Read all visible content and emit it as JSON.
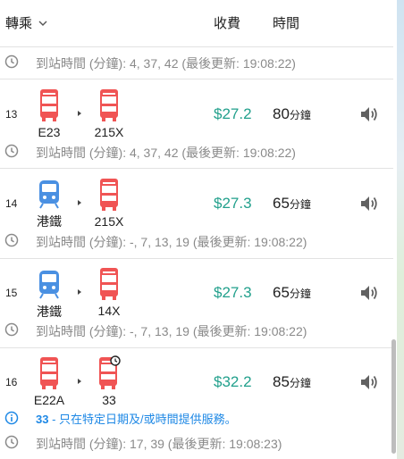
{
  "header": {
    "transfer_label": "轉乘",
    "fare_label": "收費",
    "time_label": "時間"
  },
  "eta_top": "到站時間 (分鐘): 4, 37, 42 (最後更新: 19:08:22)",
  "routes": [
    {
      "index": "13",
      "legs": [
        {
          "mode": "bus",
          "label": "E23"
        },
        {
          "mode": "bus",
          "label": "215X"
        }
      ],
      "fare": "$27.2",
      "duration": "80",
      "duration_unit": "分鐘",
      "eta": "到站時間 (分鐘): 4, 37, 42 (最後更新: 19:08:22)"
    },
    {
      "index": "14",
      "legs": [
        {
          "mode": "rail",
          "label": "港鐵"
        },
        {
          "mode": "bus",
          "label": "215X"
        }
      ],
      "fare": "$27.3",
      "duration": "65",
      "duration_unit": "分鐘",
      "eta": "到站時間 (分鐘): -, 7, 13, 19 (最後更新: 19:08:22)"
    },
    {
      "index": "15",
      "legs": [
        {
          "mode": "rail",
          "label": "港鐵"
        },
        {
          "mode": "bus",
          "label": "14X"
        }
      ],
      "fare": "$27.3",
      "duration": "65",
      "duration_unit": "分鐘",
      "eta": "到站時間 (分鐘): -, 7, 13, 19 (最後更新: 19:08:22)"
    },
    {
      "index": "16",
      "legs": [
        {
          "mode": "bus",
          "label": "E22A"
        },
        {
          "mode": "bus-scheduled",
          "label": "33"
        }
      ],
      "fare": "$32.2",
      "duration": "85",
      "duration_unit": "分鐘",
      "notice_route": "33",
      "notice_text": " - 只在特定日期及/或時間提供服務。",
      "eta": "到站時間 (分鐘): 17, 39 (最後更新: 19:08:23)"
    }
  ],
  "colors": {
    "bus": "#f05454",
    "rail": "#4a90e2",
    "fare": "#22a08c",
    "notice": "#1e88e5",
    "muted": "#8a8a8a"
  },
  "icons": {
    "clock": "clock-icon",
    "speaker": "speaker-icon",
    "info": "info-icon",
    "chevron": "chevron-down-icon",
    "bus": "bus-icon",
    "rail": "train-icon"
  }
}
